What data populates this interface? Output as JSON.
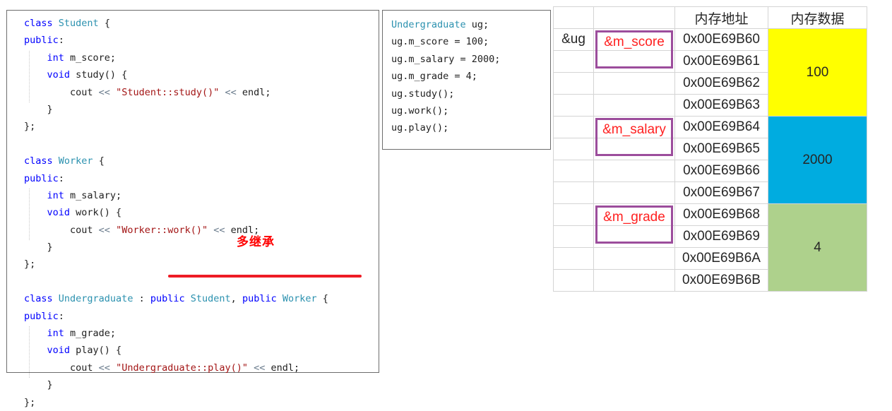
{
  "left_code": {
    "name": "class-definitions",
    "blocks": [
      {
        "id": "student",
        "lines": [
          [
            {
              "t": "class ",
              "c": "kw"
            },
            {
              "t": "Student",
              "c": "typ"
            },
            {
              "t": " {",
              "c": "pl"
            }
          ],
          [
            {
              "t": "public",
              "c": "kw"
            },
            {
              "t": ":",
              "c": "pl"
            }
          ],
          [
            {
              "t": "    ",
              "c": "pl"
            },
            {
              "t": "int",
              "c": "kw"
            },
            {
              "t": " m_score;",
              "c": "pl"
            }
          ],
          [
            {
              "t": "    ",
              "c": "pl"
            },
            {
              "t": "void",
              "c": "kw"
            },
            {
              "t": " study() {",
              "c": "pl"
            }
          ],
          [
            {
              "t": "        cout ",
              "c": "pl"
            },
            {
              "t": "<<",
              "c": "op"
            },
            {
              "t": " ",
              "c": "pl"
            },
            {
              "t": "\"Student::study()\"",
              "c": "str"
            },
            {
              "t": " ",
              "c": "pl"
            },
            {
              "t": "<<",
              "c": "op"
            },
            {
              "t": " endl;",
              "c": "pl"
            }
          ],
          [
            {
              "t": "    }",
              "c": "pl"
            }
          ],
          [
            {
              "t": "};",
              "c": "pl"
            }
          ]
        ]
      },
      {
        "id": "worker",
        "lines": [
          [
            {
              "t": "class ",
              "c": "kw"
            },
            {
              "t": "Worker",
              "c": "typ"
            },
            {
              "t": " {",
              "c": "pl"
            }
          ],
          [
            {
              "t": "public",
              "c": "kw"
            },
            {
              "t": ":",
              "c": "pl"
            }
          ],
          [
            {
              "t": "    ",
              "c": "pl"
            },
            {
              "t": "int",
              "c": "kw"
            },
            {
              "t": " m_salary;",
              "c": "pl"
            }
          ],
          [
            {
              "t": "    ",
              "c": "pl"
            },
            {
              "t": "void",
              "c": "kw"
            },
            {
              "t": " work() {",
              "c": "pl"
            }
          ],
          [
            {
              "t": "        cout ",
              "c": "pl"
            },
            {
              "t": "<<",
              "c": "op"
            },
            {
              "t": " ",
              "c": "pl"
            },
            {
              "t": "\"Worker::work()\"",
              "c": "str"
            },
            {
              "t": " ",
              "c": "pl"
            },
            {
              "t": "<<",
              "c": "op"
            },
            {
              "t": " endl;",
              "c": "pl"
            }
          ],
          [
            {
              "t": "    }",
              "c": "pl"
            }
          ],
          [
            {
              "t": "};",
              "c": "pl"
            }
          ]
        ]
      },
      {
        "id": "undergraduate",
        "lines": [
          [
            {
              "t": "class ",
              "c": "kw"
            },
            {
              "t": "Undergraduate",
              "c": "typ"
            },
            {
              "t": " : ",
              "c": "pl"
            },
            {
              "t": "public",
              "c": "kw"
            },
            {
              "t": " ",
              "c": "pl"
            },
            {
              "t": "Student",
              "c": "typ"
            },
            {
              "t": ", ",
              "c": "pl"
            },
            {
              "t": "public",
              "c": "kw"
            },
            {
              "t": " ",
              "c": "pl"
            },
            {
              "t": "Worker",
              "c": "typ"
            },
            {
              "t": " {",
              "c": "pl"
            }
          ],
          [
            {
              "t": "public",
              "c": "kw"
            },
            {
              "t": ":",
              "c": "pl"
            }
          ],
          [
            {
              "t": "    ",
              "c": "pl"
            },
            {
              "t": "int",
              "c": "kw"
            },
            {
              "t": " m_grade;",
              "c": "pl"
            }
          ],
          [
            {
              "t": "    ",
              "c": "pl"
            },
            {
              "t": "void",
              "c": "kw"
            },
            {
              "t": " play() {",
              "c": "pl"
            }
          ],
          [
            {
              "t": "        cout ",
              "c": "pl"
            },
            {
              "t": "<<",
              "c": "op"
            },
            {
              "t": " ",
              "c": "pl"
            },
            {
              "t": "\"Undergraduate::play()\"",
              "c": "str"
            },
            {
              "t": " ",
              "c": "pl"
            },
            {
              "t": "<<",
              "c": "op"
            },
            {
              "t": " endl;",
              "c": "pl"
            }
          ],
          [
            {
              "t": "    }",
              "c": "pl"
            }
          ],
          [
            {
              "t": "};",
              "c": "pl"
            }
          ]
        ]
      }
    ]
  },
  "annotations": {
    "multi_inherit_label": "多继承",
    "multi_inherit_color": "#ff0000",
    "underline_color": "#ee1c25"
  },
  "main_code": {
    "name": "usage-snippet",
    "lines": [
      [
        {
          "t": "Undergraduate",
          "c": "typ"
        },
        {
          "t": " ug;",
          "c": "pl"
        }
      ],
      [
        {
          "t": "ug.m_score = 100;",
          "c": "pl"
        }
      ],
      [
        {
          "t": "ug.m_salary = 2000;",
          "c": "pl"
        }
      ],
      [
        {
          "t": "ug.m_grade = 4;",
          "c": "pl"
        }
      ],
      [
        {
          "t": "ug.study();",
          "c": "pl"
        }
      ],
      [
        {
          "t": "ug.work();",
          "c": "pl"
        }
      ],
      [
        {
          "t": "ug.play();",
          "c": "pl"
        }
      ]
    ]
  },
  "memory_table": {
    "headers": [
      "",
      "",
      "内存地址",
      "内存数据"
    ],
    "object_label": "&ug",
    "members": [
      {
        "label": "&m_score",
        "color": "#ffff00",
        "value": "100"
      },
      {
        "label": "&m_salary",
        "color": "#00ace0",
        "value": "2000"
      },
      {
        "label": "&m_grade",
        "color": "#aed18c",
        "value": "4"
      }
    ],
    "rows": [
      {
        "ug": "&ug",
        "member": "&m_score",
        "addr": "0x00E69B60",
        "hot": true,
        "data": "100",
        "fill": "yellow",
        "span": 4
      },
      {
        "ug": "",
        "member": "",
        "addr": "0x00E69B61",
        "hot": false
      },
      {
        "ug": "",
        "member": "",
        "addr": "0x00E69B62",
        "hot": false
      },
      {
        "ug": "",
        "member": "",
        "addr": "0x00E69B63",
        "hot": false
      },
      {
        "ug": "",
        "member": "&m_salary",
        "addr": "0x00E69B64",
        "hot": true,
        "data": "2000",
        "fill": "cyan",
        "span": 4
      },
      {
        "ug": "",
        "member": "",
        "addr": "0x00E69B65",
        "hot": false
      },
      {
        "ug": "",
        "member": "",
        "addr": "0x00E69B66",
        "hot": false
      },
      {
        "ug": "",
        "member": "",
        "addr": "0x00E69B67",
        "hot": false
      },
      {
        "ug": "",
        "member": "&m_grade",
        "addr": "0x00E69B68",
        "hot": true,
        "data": "4",
        "fill": "green",
        "span": 4
      },
      {
        "ug": "",
        "member": "",
        "addr": "0x00E69B69",
        "hot": false
      },
      {
        "ug": "",
        "member": "",
        "addr": "0x00E69B6A",
        "hot": false
      },
      {
        "ug": "",
        "member": "",
        "addr": "0x00E69B6B",
        "hot": false
      }
    ]
  },
  "colors": {
    "keyword": "#0000ff",
    "type": "#2b91af",
    "string": "#a31515",
    "operator": "#6a7b8c",
    "highlight_red": "#ff2020",
    "box_purple": "#9c4d9c"
  }
}
